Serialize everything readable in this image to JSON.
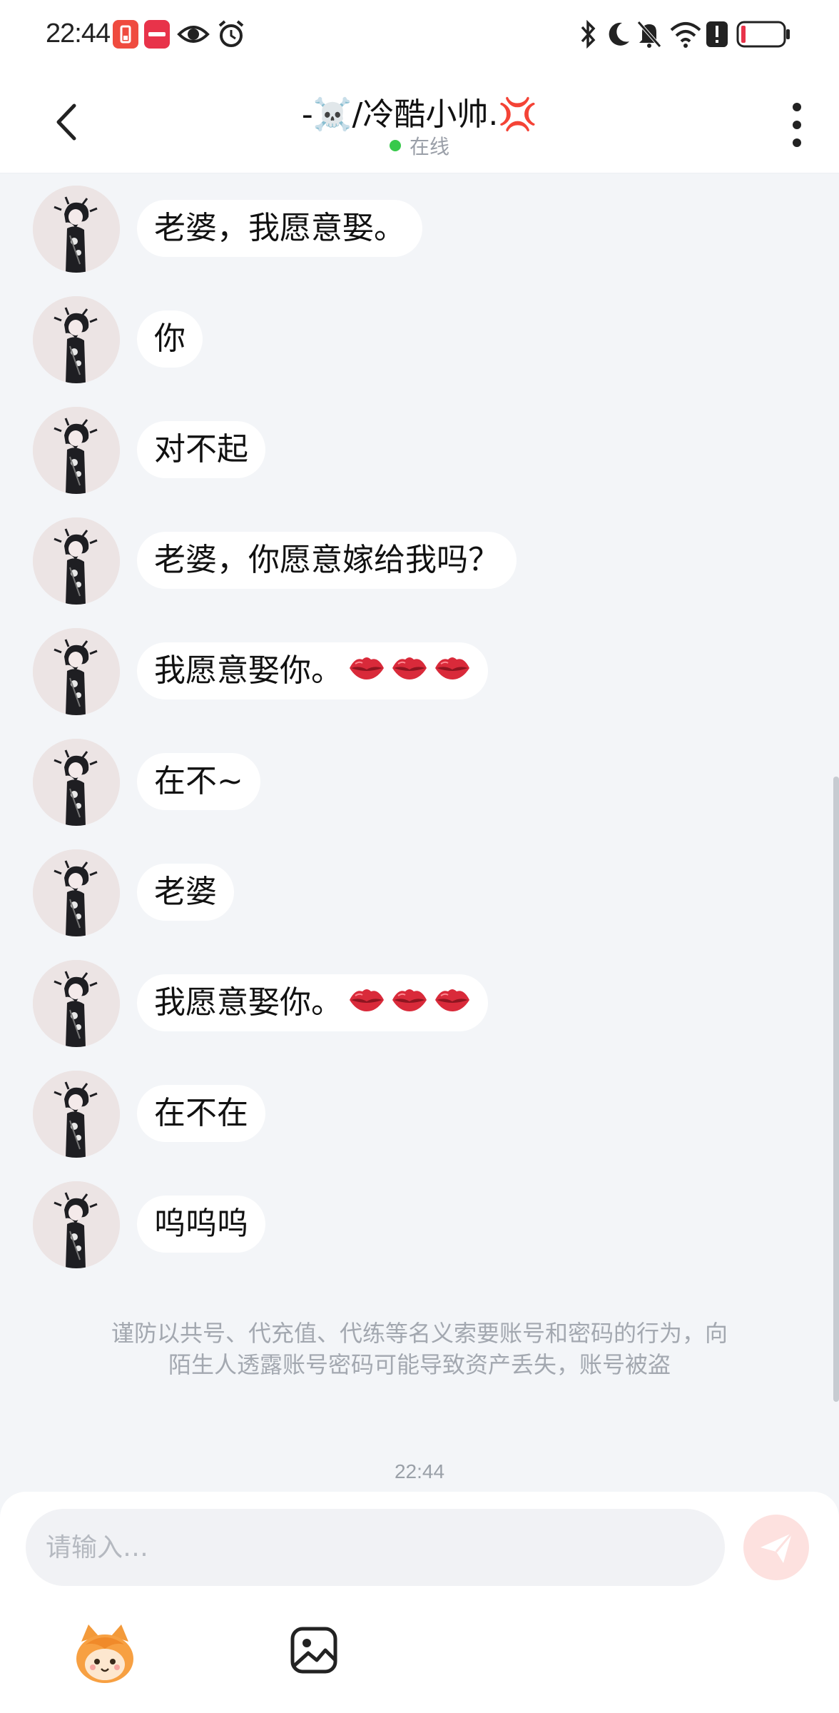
{
  "status_bar": {
    "time": "22:44",
    "icons": [
      "battery-saver-icon",
      "xiaohongshu-icon",
      "eye-icon",
      "alarm-icon",
      "bluetooth-icon",
      "moon-icon",
      "mute-icon",
      "wifi-icon",
      "alert-icon",
      "battery-icon"
    ],
    "accent": "#e8334a"
  },
  "header": {
    "title": "-☠️/冷酷小帅.💢",
    "status": "在线",
    "status_color": "#37c94b"
  },
  "messages": [
    {
      "text": "老婆，我愿意娶。",
      "lips": 0
    },
    {
      "text": "你",
      "lips": 0
    },
    {
      "text": "对不起",
      "lips": 0
    },
    {
      "text": "老婆，你愿意嫁给我吗？",
      "lips": 0
    },
    {
      "text": "我愿意娶你。",
      "lips": 3
    },
    {
      "text": "在不~",
      "lips": 0
    },
    {
      "text": "老婆",
      "lips": 0
    },
    {
      "text": "我愿意娶你。",
      "lips": 3
    },
    {
      "text": "在不在",
      "lips": 0
    },
    {
      "text": "呜呜呜",
      "lips": 0
    }
  ],
  "notice": {
    "line1": "谨防以共号、代充值、代练等名义索要账号和密码的行为，向",
    "line2": "陌生人透露账号密码可能导致资产丢失，账号被盗"
  },
  "timestamp": "22:44",
  "composer": {
    "placeholder": "请输入…",
    "send_icon": "send-icon",
    "emoji_icon": "emoji-sticker-icon",
    "image_icon": "image-icon"
  }
}
